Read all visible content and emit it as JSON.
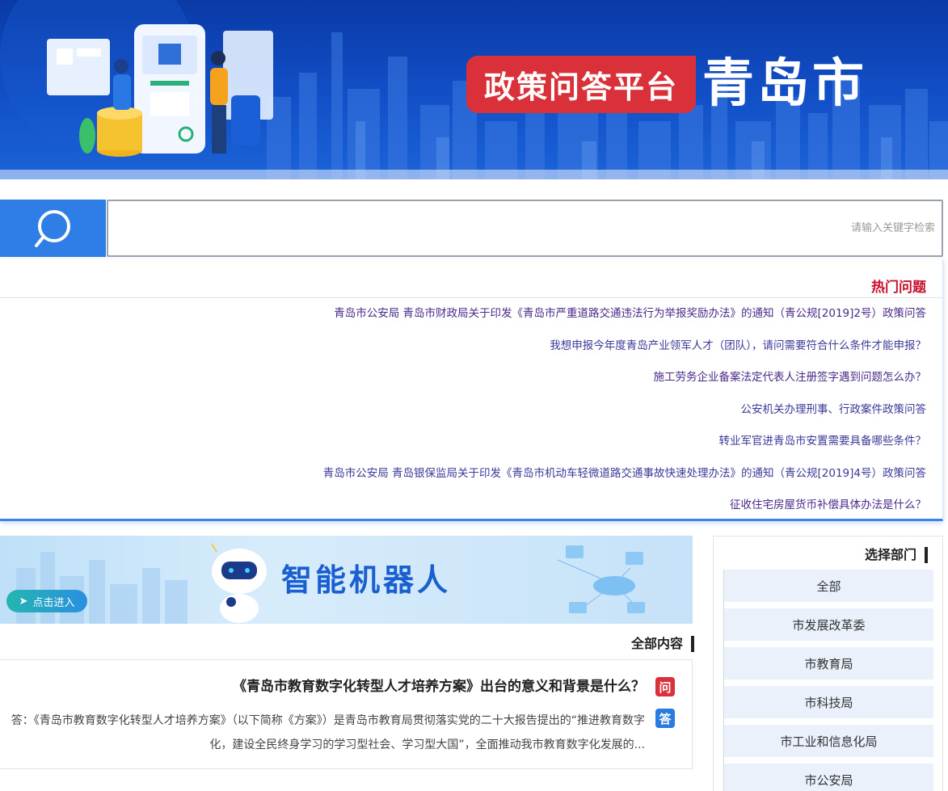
{
  "header": {
    "title_main": "青岛市",
    "title_sub": "政策问答平台"
  },
  "search": {
    "placeholder": "请输入关键字检索",
    "icon": "search-icon",
    "accent": "#2f7de6"
  },
  "hot": {
    "title": "热门问题",
    "title_color": "#c8102e",
    "items": [
      "青岛市公安局 青岛市财政局关于印发《青岛市严重道路交通违法行为举报奖励办法》的通知（青公规[2019]2号）政策问答",
      "我想申报今年度青岛产业领军人才（团队），请问需要符合什么条件才能申报？",
      "施工劳务企业备案法定代表人注册签字遇到问题怎么办？",
      "公安机关办理刑事、行政案件政策问答",
      "转业军官进青岛市安置需要具备哪些条件？",
      "青岛市公安局 青岛银保监局关于印发《青岛市机动车轻微道路交通事故快速处理办法》的通知（青公规[2019]4号）政策问答",
      "征收住宅房屋货币补偿具体办法是什么？"
    ]
  },
  "robot": {
    "title": "智能机器人",
    "enter_label": "点击进入"
  },
  "content": {
    "section_title": "全部内容",
    "q_badge": "问",
    "a_badge": "答",
    "question": "《青岛市教育数字化转型人才培养方案》出台的意义和背景是什么？",
    "answer": "答：《青岛市教育数字化转型人才培养方案》（以下简称《方案》）是青岛市教育局贯彻落实党的二十大报告提出的“推进教育数字化，建设全民终身学习的学习型社会、学习型大国”，全面推动我市教育数字化发展的..."
  },
  "departments": {
    "title": "选择部门",
    "items": [
      "全部",
      "市发展改革委",
      "市教育局",
      "市科技局",
      "市工业和信息化局",
      "市公安局"
    ]
  }
}
